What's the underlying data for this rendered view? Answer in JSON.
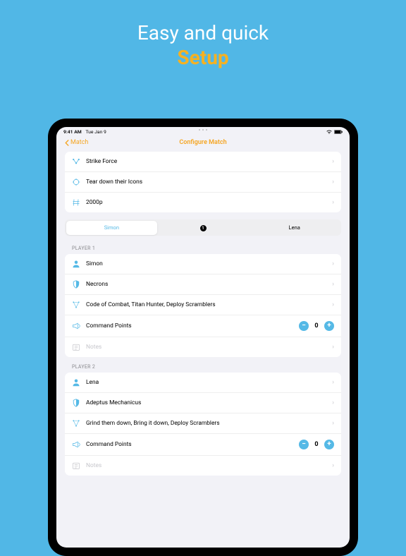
{
  "promo": {
    "line1": "Easy and quick",
    "line2": "Setup"
  },
  "status": {
    "time": "9:41 AM",
    "date": "Tue Jan 9"
  },
  "nav": {
    "back": "Match",
    "title": "Configure Match"
  },
  "match_settings": {
    "force": "Strike Force",
    "mission": "Tear down their Icons",
    "points": "2000p"
  },
  "segmented": {
    "left": "Simon",
    "middle_badge": "1",
    "right": "Lena"
  },
  "player1": {
    "header": "PLAYER 1",
    "name": "Simon",
    "faction": "Necrons",
    "objectives": "Code of Combat, Titan Hunter, Deploy Scramblers",
    "cp_label": "Command Points",
    "cp_value": "0",
    "notes": "Notes"
  },
  "player2": {
    "header": "PLAYER 2",
    "name": "Lena",
    "faction": "Adeptus Mechanicus",
    "objectives": "Grind them down, Bring it down, Deploy Scramblers",
    "cp_label": "Command Points",
    "cp_value": "0",
    "notes": "Notes"
  }
}
